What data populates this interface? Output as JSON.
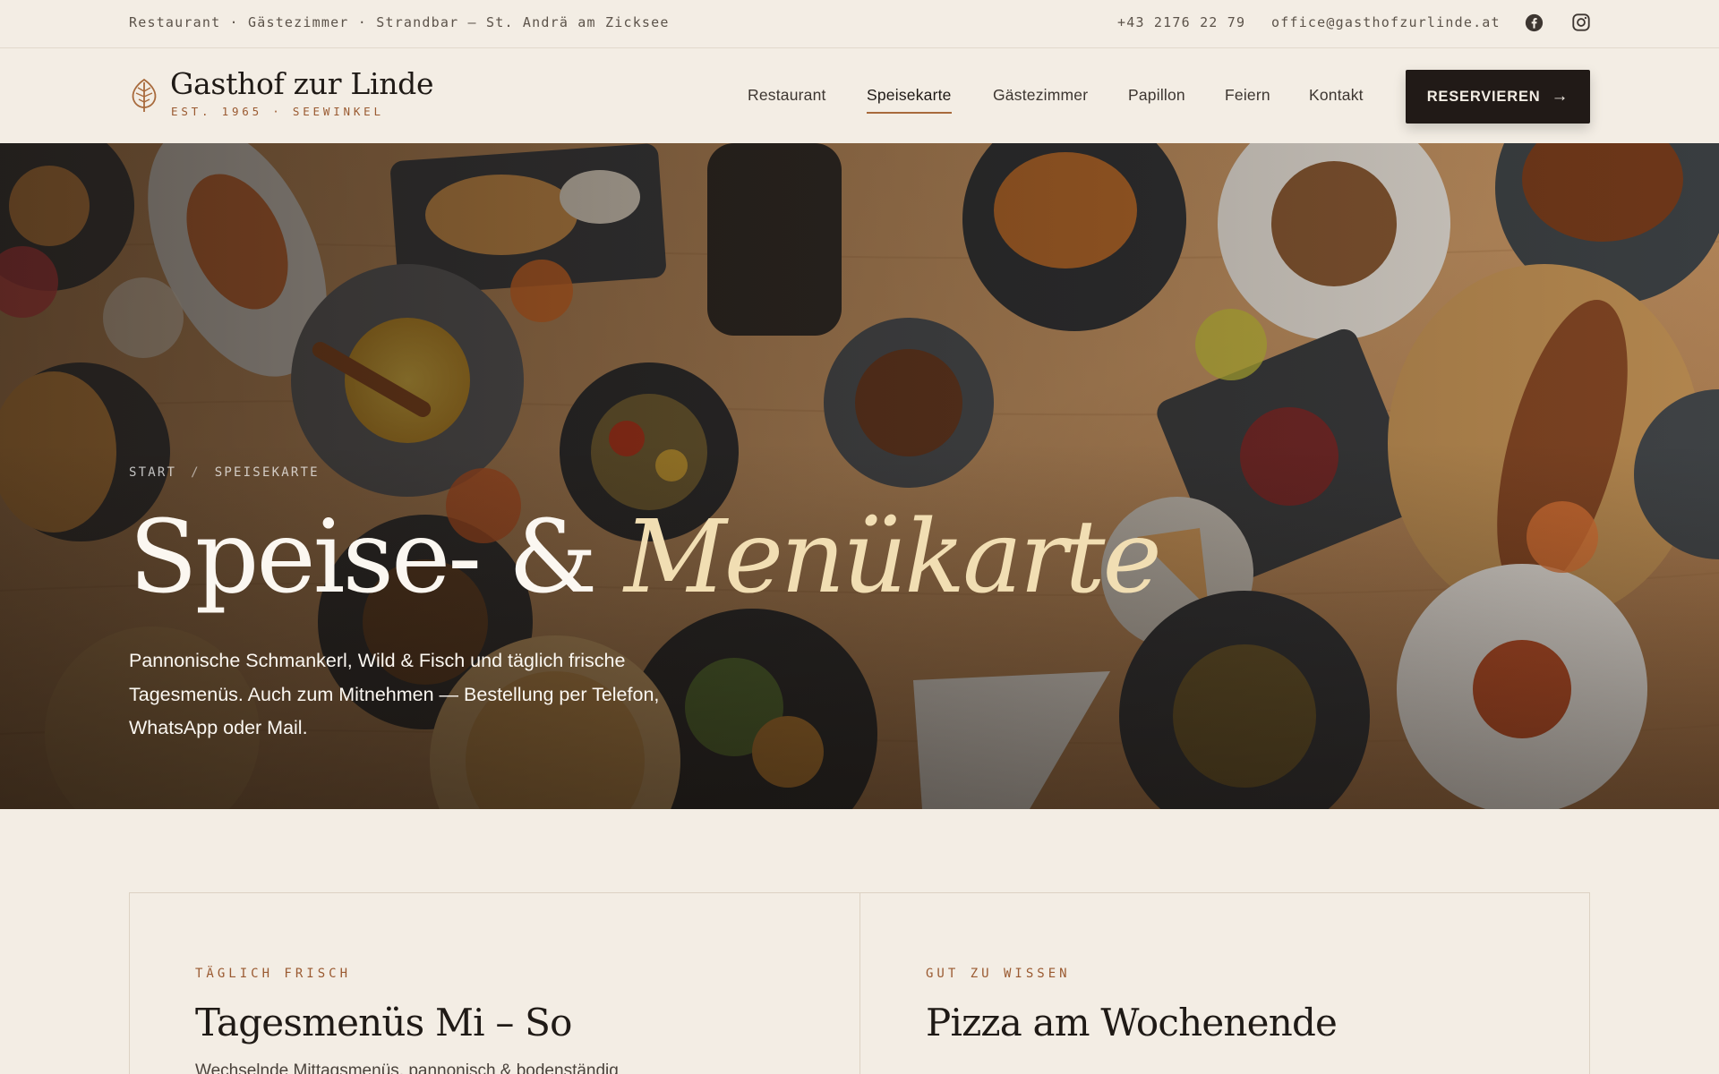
{
  "topbar": {
    "tagline": "Restaurant · Gästezimmer · Strandbar — St. Andrä am Zicksee",
    "phone": "+43 2176 22 79",
    "email": "office@gasthofzurlinde.at",
    "social_icons": [
      "facebook-icon",
      "instagram-icon"
    ]
  },
  "header": {
    "logo_name": "Gasthof zur Linde",
    "logo_sub": "EST. 1965 · SEEWINKEL",
    "logo_icon": "linden-leaf-icon",
    "nav": [
      {
        "label": "Restaurant",
        "active": false
      },
      {
        "label": "Speisekarte",
        "active": true
      },
      {
        "label": "Gästezimmer",
        "active": false
      },
      {
        "label": "Papillon",
        "active": false
      },
      {
        "label": "Feiern",
        "active": false
      },
      {
        "label": "Kontakt",
        "active": false
      }
    ],
    "cta_label": "RESERVIEREN",
    "cta_icon": "arrow-right-icon"
  },
  "hero": {
    "breadcrumb": [
      "START",
      "SPEISEKARTE"
    ],
    "breadcrumb_separator": "/",
    "title_main": "Speise- &",
    "title_accent": "Menükarte",
    "lead": "Pannonische Schmankerl, Wild & Fisch und täglich frische Tagesmenüs. Auch zum Mitnehmen — Bestellung per Telefon, WhatsApp oder Mail.",
    "image": "overhead-photo-of-dishes-on-wooden-table"
  },
  "cards": [
    {
      "eyebrow": "TÄGLICH FRISCH",
      "title": "Tagesmenüs Mi – So",
      "text": "Wechselnde Mittagsmenüs, pannonisch & bodenständig"
    },
    {
      "eyebrow": "GUT ZU WISSEN",
      "title": "Pizza am Wochenende",
      "text": ""
    }
  ],
  "colors": {
    "background": "#f3ede4",
    "accent": "#9a5a31",
    "dark": "#211a17",
    "hero_accent_text": "#f1deb3"
  }
}
